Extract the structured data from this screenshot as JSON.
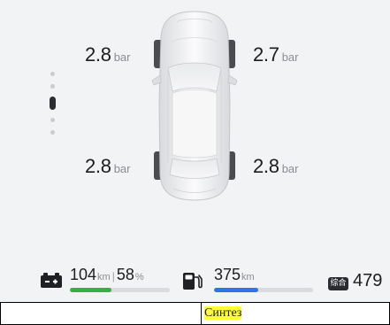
{
  "pager": {
    "dots": 5,
    "active_index": 2
  },
  "tires": {
    "front_left": {
      "value": "2.8",
      "unit": "bar"
    },
    "front_right": {
      "value": "2.7",
      "unit": "bar"
    },
    "rear_left": {
      "value": "2.8",
      "unit": "bar"
    },
    "rear_right": {
      "value": "2.8",
      "unit": "bar"
    }
  },
  "status": {
    "battery": {
      "icon": "battery-icon",
      "range_value": "104",
      "range_unit": "km",
      "separator": "|",
      "percent_value": "58",
      "percent_unit": "%",
      "level_fraction": 0.42,
      "bar_color": "#2fb24c"
    },
    "fuel": {
      "icon": "fuel-pump-icon",
      "range_value": "375",
      "range_unit": "km",
      "level_fraction": 0.45,
      "bar_color": "#2f74e6"
    },
    "combined": {
      "badge": "综合",
      "range_value": "479"
    }
  },
  "table": {
    "cell_left": "",
    "cell_right": "Синтез"
  }
}
